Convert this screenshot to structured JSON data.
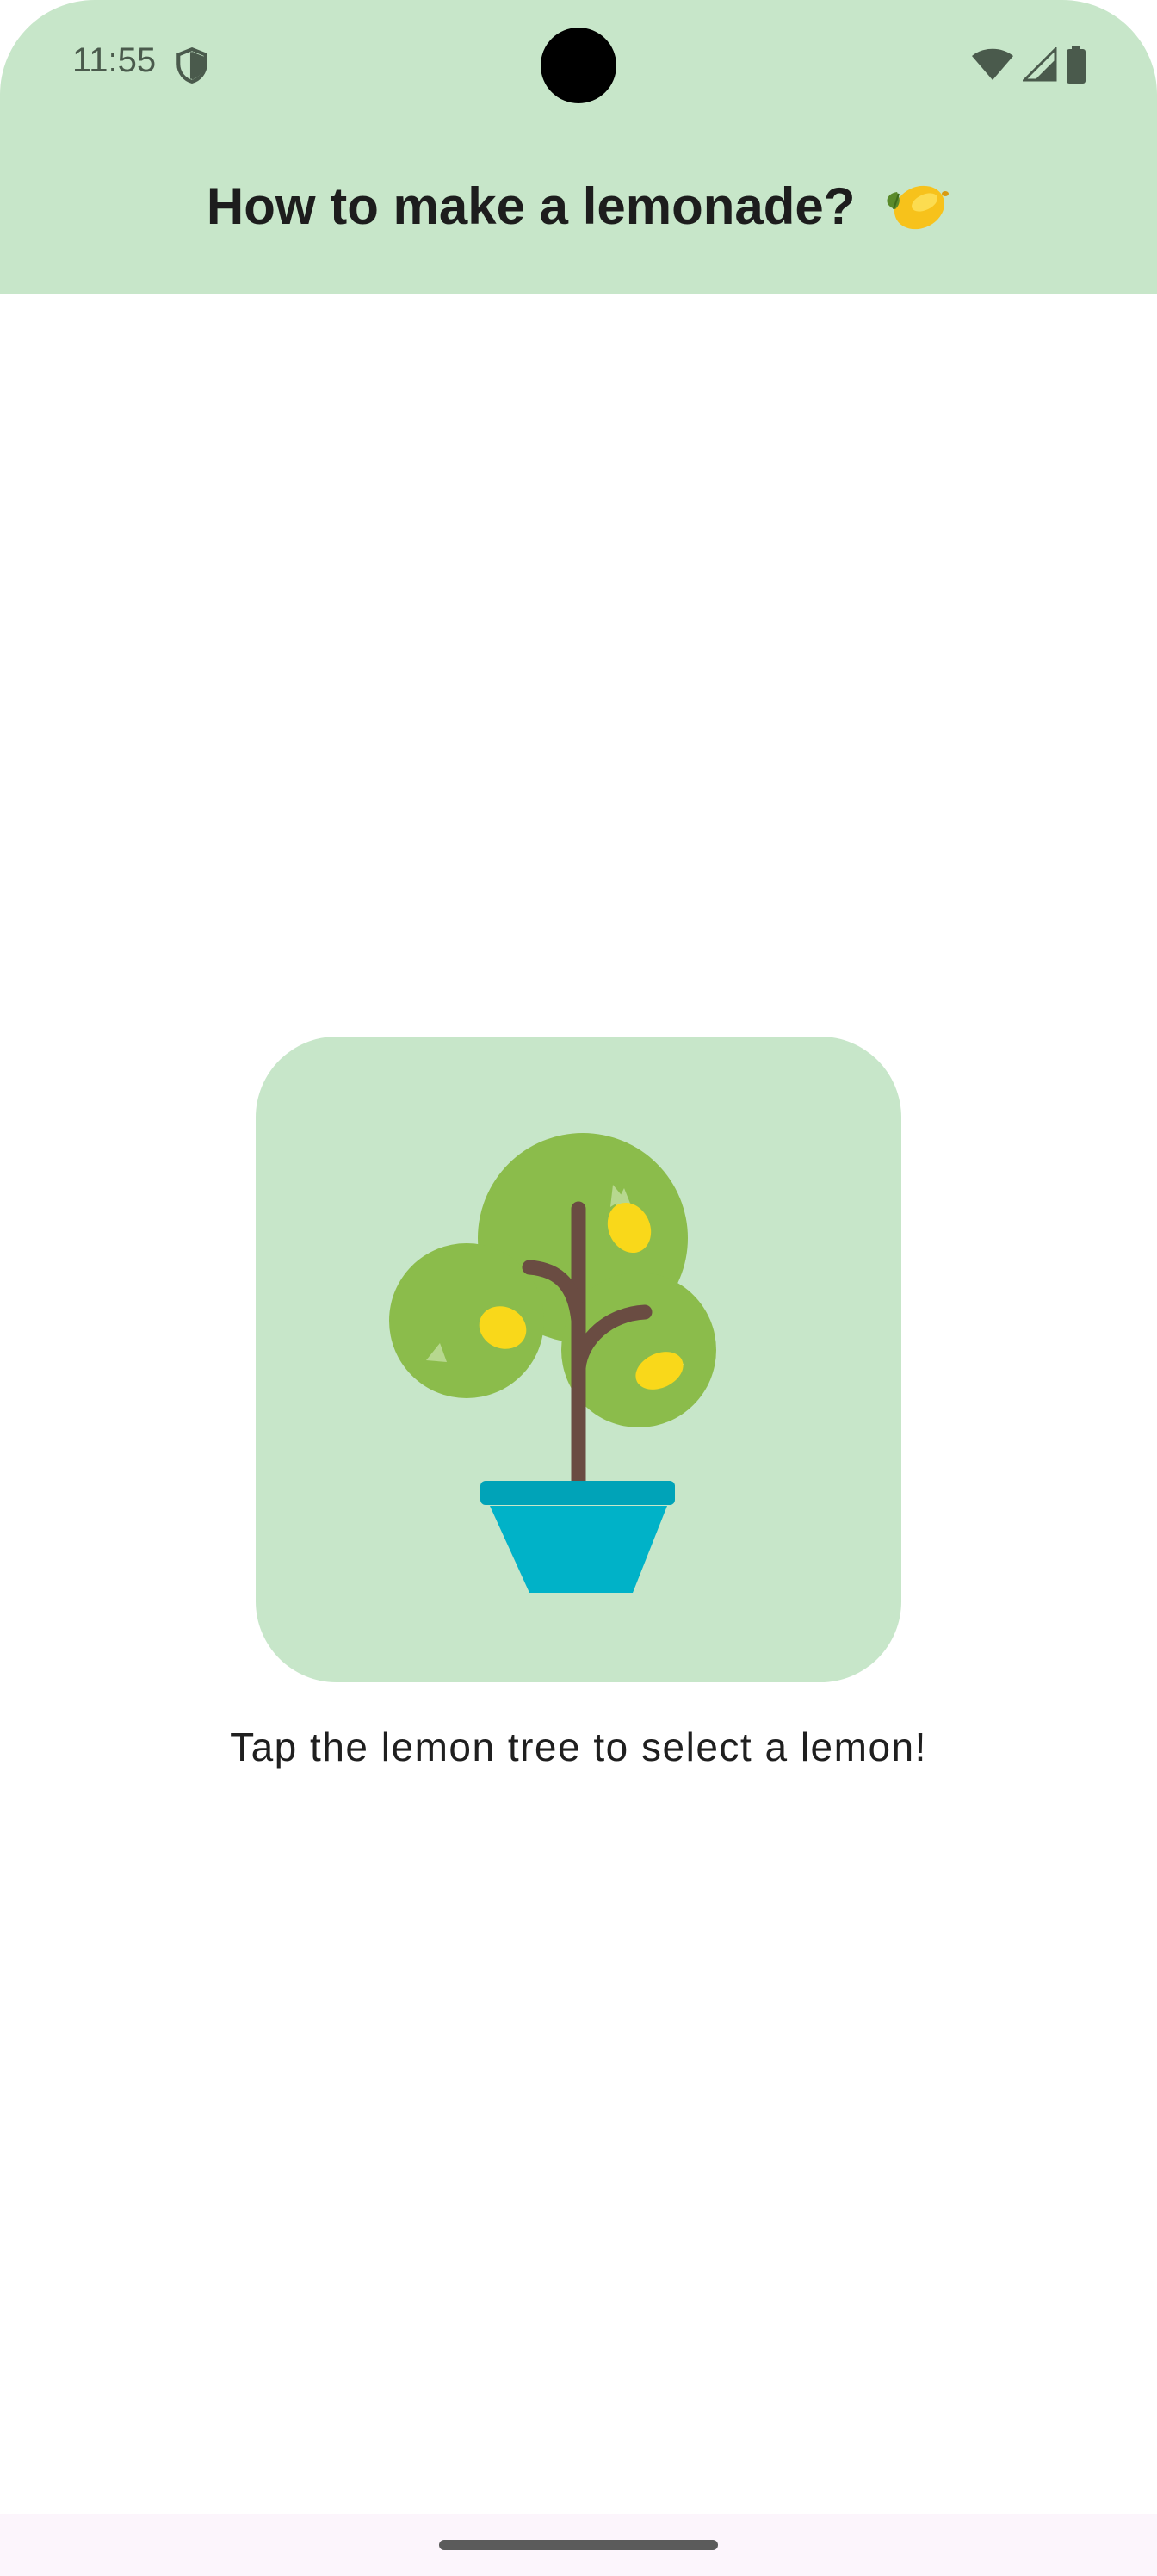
{
  "status_bar": {
    "time": "11:55",
    "icons": [
      "shield-icon",
      "wifi-icon",
      "signal-icon",
      "battery-icon"
    ]
  },
  "app_bar": {
    "title": "How to make a lemonade?",
    "title_emoji": "lemon-emoji"
  },
  "main": {
    "image_icon": "lemon-tree-icon",
    "instruction": "Tap the lemon tree to select a lemon!"
  },
  "colors": {
    "header_background": "#c7e6c9",
    "card_background": "#c7e6c9",
    "foliage": "#8bbc4b",
    "trunk": "#6a4c42",
    "lemon": "#f9d81a",
    "pot": "#00b2c8",
    "pot_rim": "#00a3b8"
  }
}
